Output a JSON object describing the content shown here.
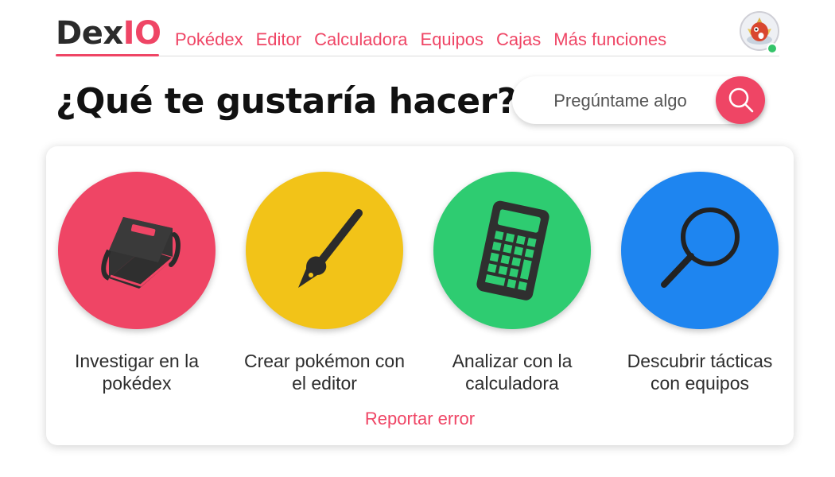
{
  "header": {
    "logo_part1": "Dex",
    "logo_part2": "IO",
    "nav": [
      "Pokédex",
      "Editor",
      "Calculadora",
      "Equipos",
      "Cajas",
      "Más funciones"
    ]
  },
  "main": {
    "title": "¿Qué te gustaría hacer?",
    "search": {
      "placeholder": "Pregúntame algo"
    }
  },
  "actions": [
    {
      "label": "Investigar en la pokédex",
      "icon": "book-icon",
      "color": "#ef4565"
    },
    {
      "label": "Crear pokémon con el editor",
      "icon": "pen-icon",
      "color": "#f2c318"
    },
    {
      "label": "Analizar con la calculadora",
      "icon": "calculator-icon",
      "color": "#2ecc71"
    },
    {
      "label": "Descubrir tácticas con equipos",
      "icon": "magnifier-icon",
      "color": "#1e85f0"
    }
  ],
  "footer": {
    "report": "Reportar error"
  },
  "colors": {
    "accent": "#ef4565",
    "online": "#35c46a"
  }
}
